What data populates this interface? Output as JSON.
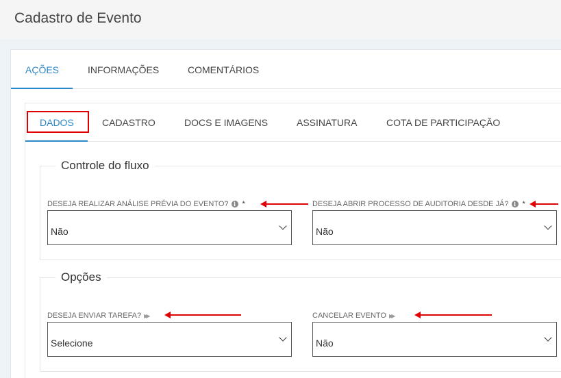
{
  "page": {
    "title": "Cadastro de Evento"
  },
  "tabs_main": [
    {
      "label": "AÇÕES",
      "active": true
    },
    {
      "label": "INFORMAÇÕES",
      "active": false
    },
    {
      "label": "COMENTÁRIOS",
      "active": false
    }
  ],
  "tabs_sub": [
    {
      "label": "DADOS",
      "active": true
    },
    {
      "label": "CADASTRO",
      "active": false
    },
    {
      "label": "DOCS E IMAGENS",
      "active": false
    },
    {
      "label": "ASSINATURA",
      "active": false
    },
    {
      "label": "COTA DE PARTICIPAÇÃO",
      "active": false
    }
  ],
  "controle_fluxo": {
    "legend": "Controle do fluxo",
    "field1": {
      "label": "DESEJA REALIZAR ANÁLISE PRÉVIA DO EVENTO?",
      "required": "*",
      "value": "Não"
    },
    "field2": {
      "label": "DESEJA ABRIR PROCESSO DE AUDITORIA DESDE JÁ?",
      "required": "*",
      "value": "Não"
    }
  },
  "opcoes": {
    "legend": "Opções",
    "field1": {
      "label": "DESEJA ENVIAR TAREFA?",
      "value": "Selecione"
    },
    "field2": {
      "label": "CANCELAR EVENTO",
      "value": "Não"
    }
  },
  "icons": {
    "info": "info-icon",
    "play": "play-icon",
    "chevron": "chevron-down-icon"
  },
  "colors": {
    "accent": "#2a88c8",
    "annotation": "#e00000"
  }
}
